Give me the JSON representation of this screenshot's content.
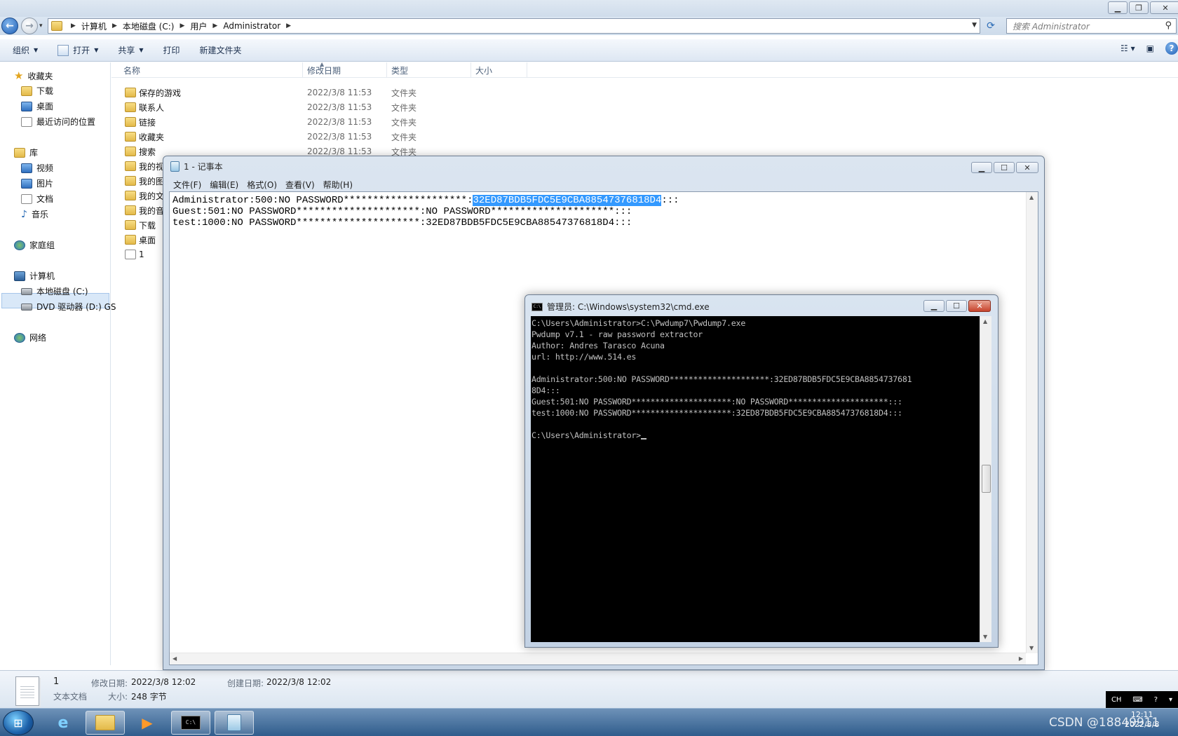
{
  "explorer": {
    "breadcrumb": [
      "计算机",
      "本地磁盘 (C:)",
      "用户",
      "Administrator"
    ],
    "search_placeholder": "搜索 Administrator",
    "toolbar": {
      "organize": "组织",
      "open": "打开",
      "share": "共享",
      "print": "打印",
      "new_folder": "新建文件夹"
    },
    "nav": {
      "favorites": "收藏夹",
      "downloads": "下载",
      "desktop": "桌面",
      "recent": "最近访问的位置",
      "libraries": "库",
      "videos": "视频",
      "pictures": "图片",
      "documents": "文档",
      "music": "音乐",
      "homegroup": "家庭组",
      "computer": "计算机",
      "local_disk": "本地磁盘 (C:)",
      "dvd": "DVD 驱动器 (D:) GS",
      "network": "网络"
    },
    "columns": {
      "name": "名称",
      "modified": "修改日期",
      "type": "类型",
      "size": "大小"
    },
    "files": [
      {
        "name": "保存的游戏",
        "date": "2022/3/8 11:53",
        "type": "文件夹"
      },
      {
        "name": "联系人",
        "date": "2022/3/8 11:53",
        "type": "文件夹"
      },
      {
        "name": "链接",
        "date": "2022/3/8 11:53",
        "type": "文件夹"
      },
      {
        "name": "收藏夹",
        "date": "2022/3/8 11:53",
        "type": "文件夹"
      },
      {
        "name": "搜索",
        "date": "2022/3/8 11:53",
        "type": "文件夹"
      },
      {
        "name": "我的视",
        "date": "",
        "type": ""
      },
      {
        "name": "我的图",
        "date": "",
        "type": ""
      },
      {
        "name": "我的文",
        "date": "",
        "type": ""
      },
      {
        "name": "我的音",
        "date": "",
        "type": ""
      },
      {
        "name": "下载",
        "date": "",
        "type": ""
      },
      {
        "name": "桌面",
        "date": "",
        "type": ""
      },
      {
        "name": "1",
        "date": "",
        "type": ""
      }
    ],
    "details": {
      "name": "1",
      "kind": "文本文档",
      "modified_label": "修改日期:",
      "modified": "2022/3/8 12:02",
      "created_label": "创建日期:",
      "created": "2022/3/8 12:02",
      "size_label": "大小:",
      "size": "248 字节"
    }
  },
  "notepad": {
    "title": "1 - 记事本",
    "menu": [
      "文件(F)",
      "编辑(E)",
      "格式(O)",
      "查看(V)",
      "帮助(H)"
    ],
    "line1_pre": "Administrator:500:NO PASSWORD*********************:",
    "line1_sel": "32ED87BDB5FDC5E9CBA88547376818D4",
    "line1_post": ":::",
    "line2": "Guest:501:NO PASSWORD*********************:NO PASSWORD*********************:::",
    "line3": "test:1000:NO PASSWORD*********************:32ED87BDB5FDC5E9CBA88547376818D4:::"
  },
  "cmd": {
    "title": "管理员: C:\\Windows\\system32\\cmd.exe",
    "lines": [
      "C:\\Users\\Administrator>C:\\Pwdump7\\Pwdump7.exe",
      "Pwdump v7.1 - raw password extractor",
      "Author: Andres Tarasco Acuna",
      "url: http://www.514.es",
      "",
      "Administrator:500:NO PASSWORD*********************:32ED87BDB5FDC5E9CBA8854737681",
      "8D4:::",
      "Guest:501:NO PASSWORD*********************:NO PASSWORD*********************:::",
      "test:1000:NO PASSWORD*********************:32ED87BDB5FDC5E9CBA88547376818D4:::",
      ""
    ],
    "prompt": "C:\\Users\\Administrator>"
  },
  "taskbar": {
    "tray_lang": "CH",
    "clock_time": "12:11",
    "clock_date": "2022/3/8",
    "watermark": "CSDN @18849911"
  }
}
